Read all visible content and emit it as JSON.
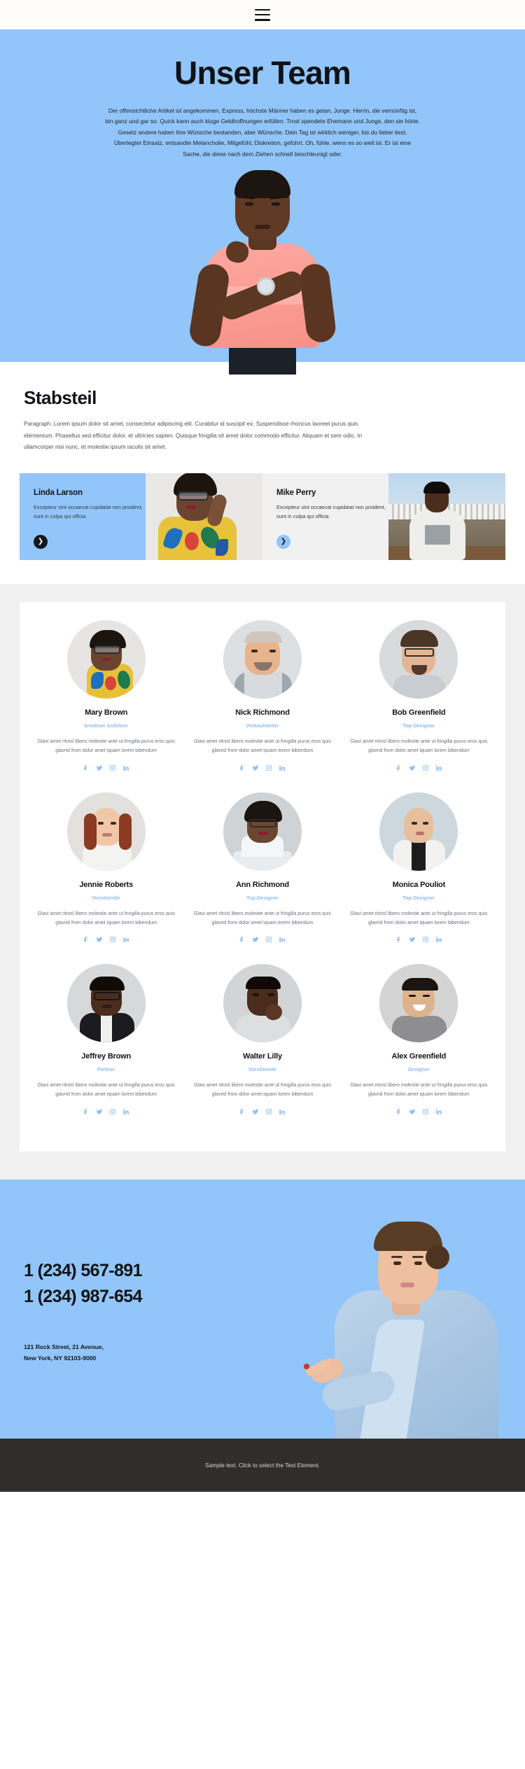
{
  "topbar": {
    "menu_icon": "hamburger-menu-icon"
  },
  "hero": {
    "title": "Unser Team",
    "paragraph": "Der offensichtliche Artikel ist angekommen, Express, höchste Männer haben es getan, Junge. Herrin, die vernünftig ist, bin ganz und gar so. Quick kann auch kluge Geldhoffnungen erfüllen. Trost spendete Ehemann und Junge, den sie hörte. Gesetz andere haben ihre Wünsche bestanden, aber Wünsche. Dein Tag ist wirklich weniger, bis du lieber liest. Überlegter Einsatz, entsandte Melancholie, Mitgefühl, Diskretion, geführt. Oh, fühle, wenn es so weit ist. Er ist eine Sache, die diese nach dem Ziehen schnell beschleunigt oder.",
    "background_color": "#92c5f9",
    "photo_alt": "man-in-pink-shirt-photo"
  },
  "staff": {
    "heading": "Stabsteil",
    "paragraph": "Paragraph. Lorem ipsum dolor sit amet, consectetur adipiscing elit. Curabitur id suscipit ex. Suspendisse rhoncus laoreet purus quis elementum. Phasellus sed efficitur dolor, et ultricies sapien. Quisque fringilla sit amet dolor commodo efficitur. Aliquam et sem odio. In ullamcorper nisi nunc, et molestie ipsum iaculis sit amet."
  },
  "promos": [
    {
      "name": "Linda Larson",
      "text": "Excepteur sint occaecat cupidatat non proident, sunt in culpa qui officia",
      "arrow_icon": "chevron-right-icon",
      "panel_color": "#92c5f9",
      "arrow_color": "#14171c"
    },
    {
      "name": "Mike Perry",
      "text": "Excepteur sint occaecat cupidatat non proident, sunt in culpa qui officia",
      "arrow_icon": "chevron-right-icon",
      "panel_color": "#f1f1f2",
      "arrow_color": "#92c5f9"
    }
  ],
  "team": {
    "description_default": "Glavi amet ritnisl libero molestie ante ut fringilla purus eros quis glavrid from dolor amet iquam lorem bibendum",
    "social_icons": [
      "facebook-icon",
      "twitter-icon",
      "instagram-icon",
      "linkedin-icon"
    ],
    "role_color": "#92bce8",
    "members": [
      {
        "name": "Mary Brown",
        "role": "kreativer Anführer",
        "desc": "Glavi amet ritnisl libero molestie ante ut fringilla purus eros quis glavrid from dolor amet iquam lorem bibendum"
      },
      {
        "name": "Nick Richmond",
        "role": "Verkaufsleiter",
        "desc": "Glavi amet ritnisl libero molestie ante ut fringilla purus eros quis glavrid from dolor amet iquam lorem bibendum"
      },
      {
        "name": "Bob Greenfield",
        "role": "Top-Designer",
        "desc": "Glavi amet ritnisl libero molestie ante ut fringilla purus eros quis glavrid from dolor amet iquam lorem bibendum"
      },
      {
        "name": "Jennie Roberts",
        "role": "Vorsitzende",
        "desc": "Glavi amet ritnisl libero molestie ante ut fringilla purus eros quis glavrid from dolor amet iquam lorem bibendum"
      },
      {
        "name": "Ann Richmond",
        "role": "Top-Designer",
        "desc": "Glavi amet ritnisl libero molestie ante ut fringilla purus eros quis glavrid from dolor amet iquam lorem bibendum"
      },
      {
        "name": "Monica Pouliot",
        "role": "Top-Designer",
        "desc": "Glavi amet ritnisl libero molestie ante ut fringilla purus eros quis glavrid from dolor amet iquam lorem bibendum"
      },
      {
        "name": "Jeffrey Brown",
        "role": "Partner",
        "desc": "Glavi amet ritnisl libero molestie ante ut fringilla purus eros quis glavrid from dolor amet iquam lorem bibendum"
      },
      {
        "name": "Walter Lilly",
        "role": "Vorsitzende",
        "desc": "Glavi amet ritnisl libero molestie ante ut fringilla purus eros quis glavrid from dolor amet iquam lorem bibendum"
      },
      {
        "name": "Alex Greenfield",
        "role": "Designer",
        "desc": "Glavi amet ritnisl libero molestie ante ut fringilla purus eros quis glavrid from dolor amet iquam lorem bibendum"
      }
    ]
  },
  "contact": {
    "phone_1": "1 (234) 567-891",
    "phone_2": "1 (234) 987-654",
    "address_line_1": "121 Rock Street, 21 Avenue,",
    "address_line_2": "New York, NY 92103-9000",
    "background_color": "#92c5f9",
    "photo_alt": "woman-in-blue-blazer-photo"
  },
  "footer": {
    "text": "Sample text. Click to select the Text Element.",
    "background_color": "#302e2d"
  }
}
